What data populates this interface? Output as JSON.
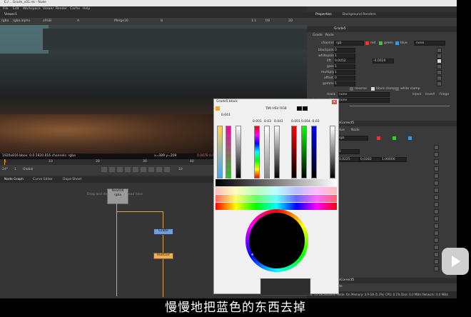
{
  "window": {
    "title": "E:/... Grade_v01.nk - Nuke"
  },
  "menu": [
    "File",
    "Edit",
    "Workspace",
    "Viewer",
    "Render",
    "Cache",
    "Help"
  ],
  "viewer": {
    "tab_label": "Viewer1",
    "toolbar": {
      "channels": "rgba",
      "alpha": "rgba.alpha",
      "colorspace": "sRGB",
      "input_a": "A",
      "input_b": "B",
      "node_a": "Merge16",
      "zoom": "1:1",
      "fstop": "f/8",
      "frame": "1",
      "mode": "2D"
    },
    "status_left": "1920x816  bbox: 0 0 1920 816 channels: rgba",
    "status_mid": "x=389 y=209",
    "status_right": "0.0678 0.0"
  },
  "timeline": {
    "frame": "1",
    "ticks": [
      "1",
      "10",
      "20",
      "30",
      "40"
    ],
    "fps": "24*",
    "inc": "10",
    "end": "1",
    "range": "Global"
  },
  "nodegraph": {
    "tabs": [
      "Node Graph",
      "Curve Editor",
      "Dope Sheet"
    ],
    "nodes": [
      {
        "label": "Read16",
        "sub": "rgba"
      },
      {
        "label": "Grade",
        "sub": ""
      },
      {
        "label": "HueCorr",
        "sub": ""
      }
    ],
    "note": "Drag and drop your new read here"
  },
  "props": {
    "tabs": [
      "Properties",
      "Background Renders"
    ],
    "grade_node": {
      "name": "Grade5",
      "tabs": [
        "Grade",
        "Node"
      ],
      "channels_label": "channels",
      "channels_value": "rgb",
      "ch_red": "red",
      "ch_green": "green",
      "ch_blue": "blue",
      "ch_none": "none",
      "rows": [
        {
          "label": "blackpoint",
          "value": "0"
        },
        {
          "label": "whitepoint",
          "value": "1"
        },
        {
          "label": "lift",
          "value": "0.0052",
          "v2": "-0.0029"
        },
        {
          "label": "gain",
          "value": "1"
        },
        {
          "label": "multiply",
          "value": "1"
        },
        {
          "label": "offset",
          "value": "0"
        },
        {
          "label": "gamma",
          "value": "1"
        }
      ],
      "reverse": "reverse",
      "black_clamp": "black clamp",
      "white_clamp": "white clamp",
      "mask_label": "mask",
      "mask_value": "none",
      "inject": "inject",
      "invert": "invert",
      "fringe": "fringe",
      "unpremult_label": "(un)premult by",
      "unpremult_value": "none",
      "mix_label": "mix"
    },
    "huecorrect_node": {
      "name": "HueCorrect5",
      "tabs": [
        "Hue",
        "Node"
      ],
      "channels_value": "rgb",
      "rows": [
        {
          "label": "sat",
          "value": "1"
        },
        {
          "label": "lum",
          "value": "0.0225",
          "v2": "0.0282",
          "v3": "1.00000"
        }
      ]
    },
    "bottom_node": {
      "name": "HueCorrect5",
      "tab": "Node"
    },
    "status_bar": "Channel Count: 15  Localization Mode: On  Memory: 3.9 GB (5.3%)  CPU: 0.1%  Disk: 0.0 MB/s  Network: 0.0 MB/s"
  },
  "picker": {
    "title": "Grade5.black",
    "mode_label": "TMI HSV RGB",
    "channels": [
      "R",
      "G",
      "B",
      "A"
    ],
    "values": {
      "col1": "0.041",
      "col2": "0.004",
      "col3": "-0.03",
      "hsv_h": "0.001",
      "hsv_s": "0.03",
      "hsv_v": "0.041",
      "rgb_r": "0.001",
      "rgb_g": "0.004",
      "rgb_b": "-0.03"
    }
  },
  "subtitle": "慢慢地把蓝色的东西去掉",
  "colors": {
    "accent": "#ff9900",
    "grade_node": "#6f9fd8",
    "huecorrect_node": "#f0b050"
  }
}
